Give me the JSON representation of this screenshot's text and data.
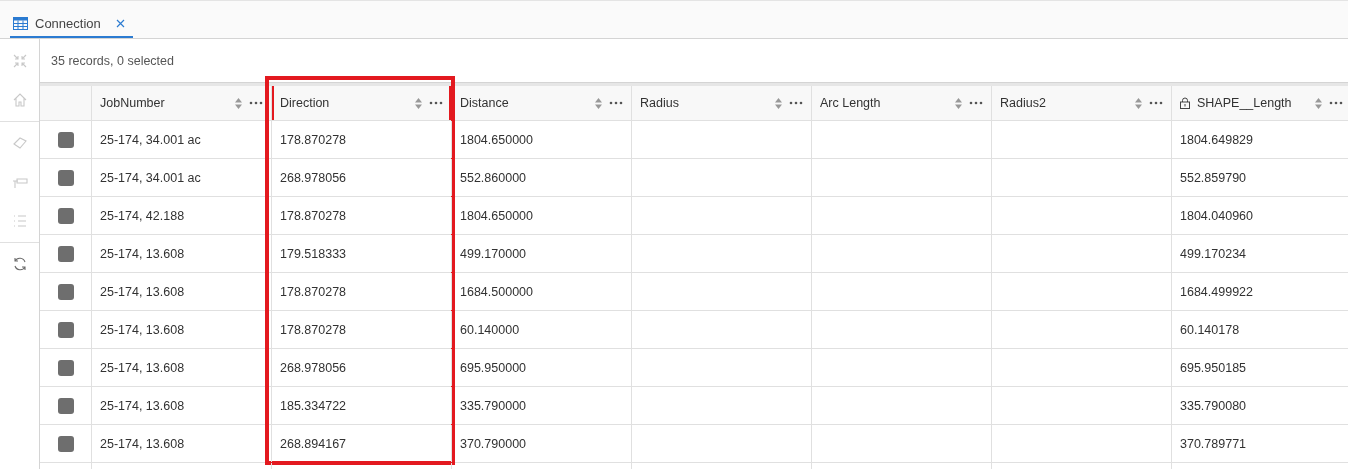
{
  "tabs": [
    {
      "label": "Connection",
      "selected": true
    }
  ],
  "toolbar": [
    {
      "kind": "collapse",
      "disabled": true
    },
    {
      "kind": "home",
      "disabled": true
    },
    {
      "kind": "eraser",
      "disabled": true
    },
    {
      "kind": "field",
      "disabled": true
    },
    {
      "kind": "list",
      "disabled": true
    },
    {
      "kind": "refresh",
      "disabled": false
    }
  ],
  "status": "35 records, 0 selected",
  "columns": [
    {
      "label": "JobNumber",
      "locked": false,
      "highlighted": false
    },
    {
      "label": "Direction",
      "locked": false,
      "highlighted": true
    },
    {
      "label": "Distance",
      "locked": false,
      "highlighted": false
    },
    {
      "label": "Radius",
      "locked": false,
      "highlighted": false
    },
    {
      "label": "Arc Length",
      "locked": false,
      "highlighted": false
    },
    {
      "label": "Radius2",
      "locked": false,
      "highlighted": false
    },
    {
      "label": "SHAPE__Length",
      "locked": true,
      "highlighted": false
    }
  ],
  "rows": [
    {
      "selected": false,
      "cells": [
        "25-174, 34.001 ac",
        "178.870278",
        "1804.650000",
        "",
        "",
        "",
        "1804.649829"
      ]
    },
    {
      "selected": false,
      "cells": [
        "25-174, 34.001 ac",
        "268.978056",
        "552.860000",
        "",
        "",
        "",
        "552.859790"
      ]
    },
    {
      "selected": false,
      "cells": [
        "25-174, 42.188",
        "178.870278",
        "1804.650000",
        "",
        "",
        "",
        "1804.040960"
      ]
    },
    {
      "selected": false,
      "cells": [
        "25-174, 13.608",
        "179.518333",
        "499.170000",
        "",
        "",
        "",
        "499.170234"
      ]
    },
    {
      "selected": false,
      "cells": [
        "25-174, 13.608",
        "178.870278",
        "1684.500000",
        "",
        "",
        "",
        "1684.499922"
      ]
    },
    {
      "selected": false,
      "cells": [
        "25-174, 13.608",
        "178.870278",
        "60.140000",
        "",
        "",
        "",
        "60.140178"
      ]
    },
    {
      "selected": false,
      "cells": [
        "25-174, 13.608",
        "268.978056",
        "695.950000",
        "",
        "",
        "",
        "695.950185"
      ]
    },
    {
      "selected": false,
      "cells": [
        "25-174, 13.608",
        "185.334722",
        "335.790000",
        "",
        "",
        "",
        "335.790080"
      ]
    },
    {
      "selected": false,
      "cells": [
        "25-174, 13.608",
        "268.894167",
        "370.790000",
        "",
        "",
        "",
        "370.789771"
      ]
    }
  ]
}
